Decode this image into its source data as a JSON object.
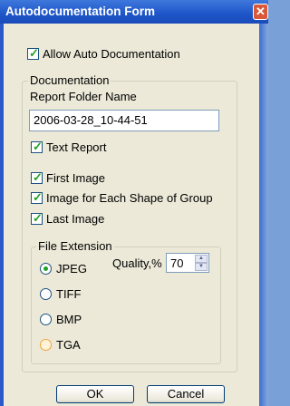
{
  "window": {
    "title": "Autodocumentation Form",
    "close_glyph": "✕"
  },
  "allow_auto": {
    "label": "Allow Auto Documentation",
    "checked": true
  },
  "documentation": {
    "legend": "Documentation",
    "folder_label": "Report Folder Name",
    "folder_value": "2006-03-28_10-44-51",
    "text_report": {
      "label": "Text Report",
      "checked": true
    },
    "first_image": {
      "label": "First Image",
      "checked": true
    },
    "each_shape": {
      "label": "Image for Each Shape of Group",
      "checked": true
    },
    "last_image": {
      "label": "Last Image",
      "checked": true
    }
  },
  "file_extension": {
    "legend": "File Extension",
    "options": [
      "JPEG",
      "TIFF",
      "BMP",
      "TGA"
    ],
    "selected": "JPEG",
    "quality_label": "Quality,%",
    "quality_value": "70"
  },
  "buttons": {
    "ok": "OK",
    "cancel": "Cancel"
  },
  "glyphs": {
    "check": "✓",
    "spin_up": "▲",
    "spin_down": "▼"
  }
}
